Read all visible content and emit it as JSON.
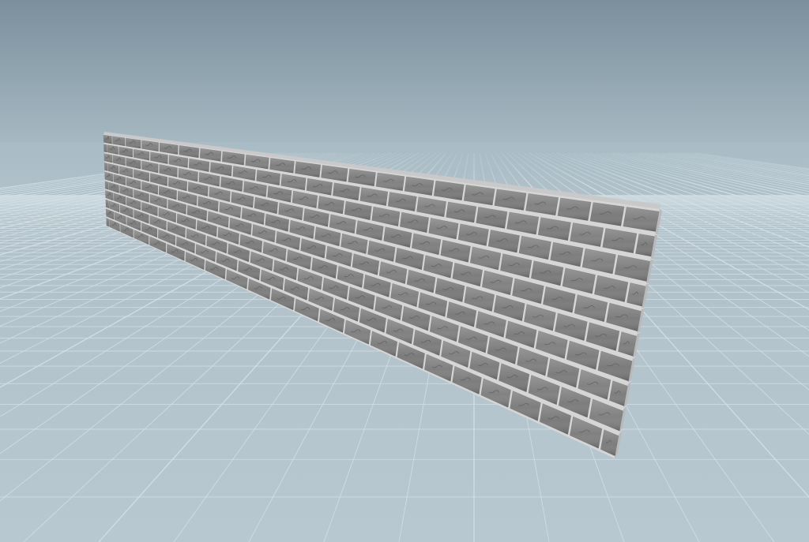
{
  "viewport": {
    "background_top_color": "#7b909d",
    "background_horizon_color": "#a9bcc5",
    "floor_color_far": "#aebfc8",
    "floor_color_near": "#b8c8d0",
    "grid_line_color": "#d3dfe5",
    "grid_major_line_color": "#c4d2d9"
  },
  "wall": {
    "object_name": "brick-wall",
    "brick_color": "#7b7b7b",
    "brick_dark_color": "#555555",
    "mortar_color": "#d6d6d6",
    "end_face_color": "#b9b9b9",
    "top_face_color": "#c9c9c9",
    "rows": 10,
    "bricks_per_row": 22
  }
}
